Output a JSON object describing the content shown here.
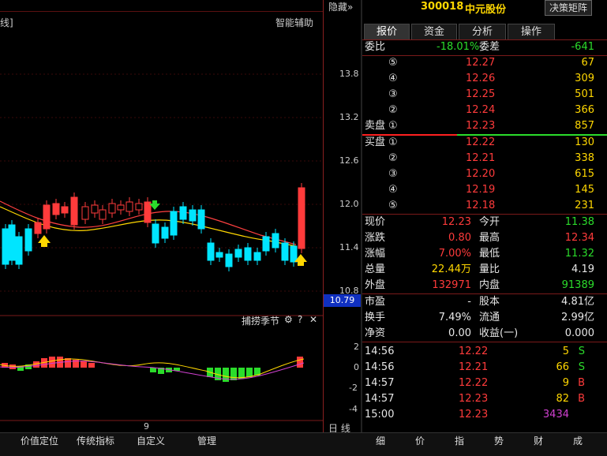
{
  "header": {
    "left_label": "线]",
    "assist_label": "智能辅助",
    "hide_label": "隐藏",
    "stock_code": "300018",
    "stock_name": "中元股份",
    "decision_btn": "决策矩阵"
  },
  "axis": {
    "ticks": [
      "13.8",
      "13.2",
      "12.6",
      "12.0",
      "11.4",
      "10.8"
    ],
    "current_price_tag": "10.79",
    "sub_ticks": [
      "2",
      "0",
      "-2",
      "-4"
    ],
    "x_label": "9",
    "line_label": "日 线"
  },
  "sub_indicator": {
    "name": "捕捞季节",
    "gear_icon": "gear-icon",
    "help": "?",
    "close": "✕"
  },
  "tabs": [
    "报价",
    "资金",
    "分析",
    "操作"
  ],
  "order_book": {
    "weibi_label": "委比",
    "weibi_value": "-18.01%",
    "weicha_label": "委差",
    "weicha_value": "-641",
    "sell_label": "卖盘",
    "buy_label": "买盘",
    "sell": [
      {
        "level": "⑤",
        "price": "12.27",
        "vol": "67"
      },
      {
        "level": "④",
        "price": "12.26",
        "vol": "309"
      },
      {
        "level": "③",
        "price": "12.25",
        "vol": "501"
      },
      {
        "level": "②",
        "price": "12.24",
        "vol": "366"
      },
      {
        "level": "①",
        "price": "12.23",
        "vol": "857"
      }
    ],
    "buy": [
      {
        "level": "①",
        "price": "12.22",
        "vol": "130"
      },
      {
        "level": "②",
        "price": "12.21",
        "vol": "338"
      },
      {
        "level": "③",
        "price": "12.20",
        "vol": "615"
      },
      {
        "level": "④",
        "price": "12.19",
        "vol": "145"
      },
      {
        "level": "⑤",
        "price": "12.18",
        "vol": "231"
      }
    ]
  },
  "stats": [
    {
      "l1": "现价",
      "v1": "12.23",
      "c1": "red",
      "l2": "今开",
      "v2": "11.38",
      "c2": "green"
    },
    {
      "l1": "涨跌",
      "v1": "0.80",
      "c1": "red",
      "l2": "最高",
      "v2": "12.34",
      "c2": "red"
    },
    {
      "l1": "涨幅",
      "v1": "7.00%",
      "c1": "red",
      "l2": "最低",
      "v2": "11.32",
      "c2": "green"
    },
    {
      "l1": "总量",
      "v1": "22.44万",
      "c1": "yellow",
      "l2": "量比",
      "v2": "4.19",
      "c2": "white"
    },
    {
      "l1": "外盘",
      "v1": "132971",
      "c1": "red",
      "l2": "内盘",
      "v2": "91389",
      "c2": "green"
    }
  ],
  "stats2": [
    {
      "l1": "市盈",
      "v1": "-",
      "l2": "股本",
      "v2": "4.81亿"
    },
    {
      "l1": "换手",
      "v1": "7.49%",
      "l2": "流通",
      "v2": "2.99亿"
    },
    {
      "l1": "净资",
      "v1": "0.00",
      "l2": "收益(一)",
      "v2": "0.000"
    }
  ],
  "ticks": [
    {
      "time": "14:56",
      "price": "12.22",
      "vol": "5",
      "side": "S",
      "vc": "yellow",
      "sc": "green"
    },
    {
      "time": "14:56",
      "price": "12.21",
      "vol": "66",
      "side": "S",
      "vc": "yellow",
      "sc": "green"
    },
    {
      "time": "14:57",
      "price": "12.22",
      "vol": "9",
      "side": "B",
      "vc": "yellow",
      "sc": "red"
    },
    {
      "time": "14:57",
      "price": "12.23",
      "vol": "82",
      "side": "B",
      "vc": "yellow",
      "sc": "red"
    },
    {
      "time": "15:00",
      "price": "12.23",
      "vol": "3434",
      "side": "",
      "vc": "magenta",
      "sc": "red"
    }
  ],
  "bottom_tabs_left": [
    "价值定位",
    "传统指标",
    "自定义",
    "管理"
  ],
  "bottom_tabs_right": [
    "细",
    "价",
    "指",
    "势",
    "财",
    "成"
  ]
}
